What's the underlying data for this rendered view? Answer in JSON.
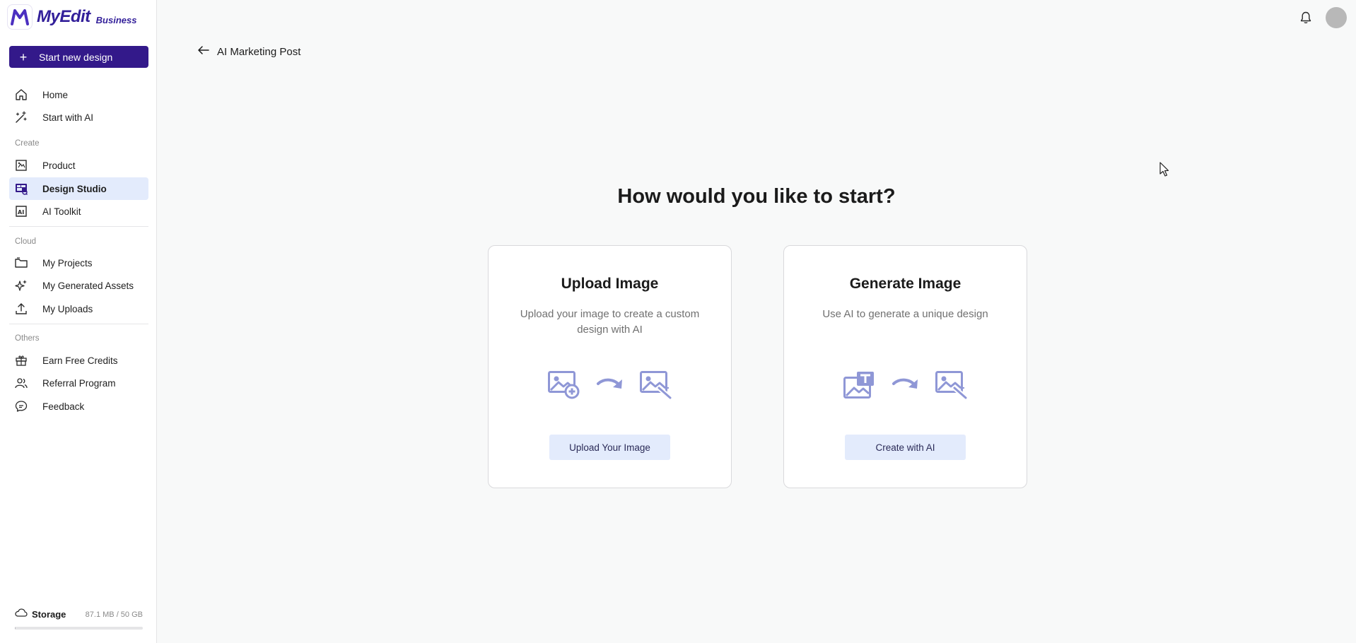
{
  "brand": {
    "name": "MyEdit",
    "tier": "Business"
  },
  "sidebar": {
    "new_button": "Start new design",
    "top_items": [
      {
        "label": "Home",
        "icon": "home-icon"
      },
      {
        "label": "Start with AI",
        "icon": "magic-wand-icon"
      }
    ],
    "sections": [
      {
        "label": "Create",
        "items": [
          {
            "label": "Product",
            "icon": "product-icon"
          },
          {
            "label": "Design Studio",
            "icon": "design-studio-icon",
            "active": true
          },
          {
            "label": "AI Toolkit",
            "icon": "ai-toolkit-icon"
          }
        ]
      },
      {
        "label": "Cloud",
        "items": [
          {
            "label": "My Projects",
            "icon": "folder-icon"
          },
          {
            "label": "My Generated Assets",
            "icon": "sparkle-icon"
          },
          {
            "label": "My Uploads",
            "icon": "upload-icon"
          }
        ]
      },
      {
        "label": "Others",
        "items": [
          {
            "label": "Earn Free Credits",
            "icon": "gift-icon"
          },
          {
            "label": "Referral Program",
            "icon": "users-icon"
          },
          {
            "label": "Feedback",
            "icon": "chat-bubble-icon"
          }
        ]
      }
    ],
    "storage": {
      "label": "Storage",
      "value": "87.1 MB / 50 GB",
      "used_fraction": 0.0017
    }
  },
  "header": {
    "back_title": "AI Marketing Post"
  },
  "main": {
    "heading": "How would you like to start?",
    "cards": [
      {
        "title": "Upload Image",
        "description": "Upload your image to create a custom design with AI",
        "button": "Upload Your Image"
      },
      {
        "title": "Generate Image",
        "description": "Use AI to generate a unique design",
        "button": "Create with AI"
      }
    ]
  },
  "colors": {
    "brand": "#33198a",
    "active_bg": "#e3ebfc",
    "illustration": "#8f97d6"
  }
}
